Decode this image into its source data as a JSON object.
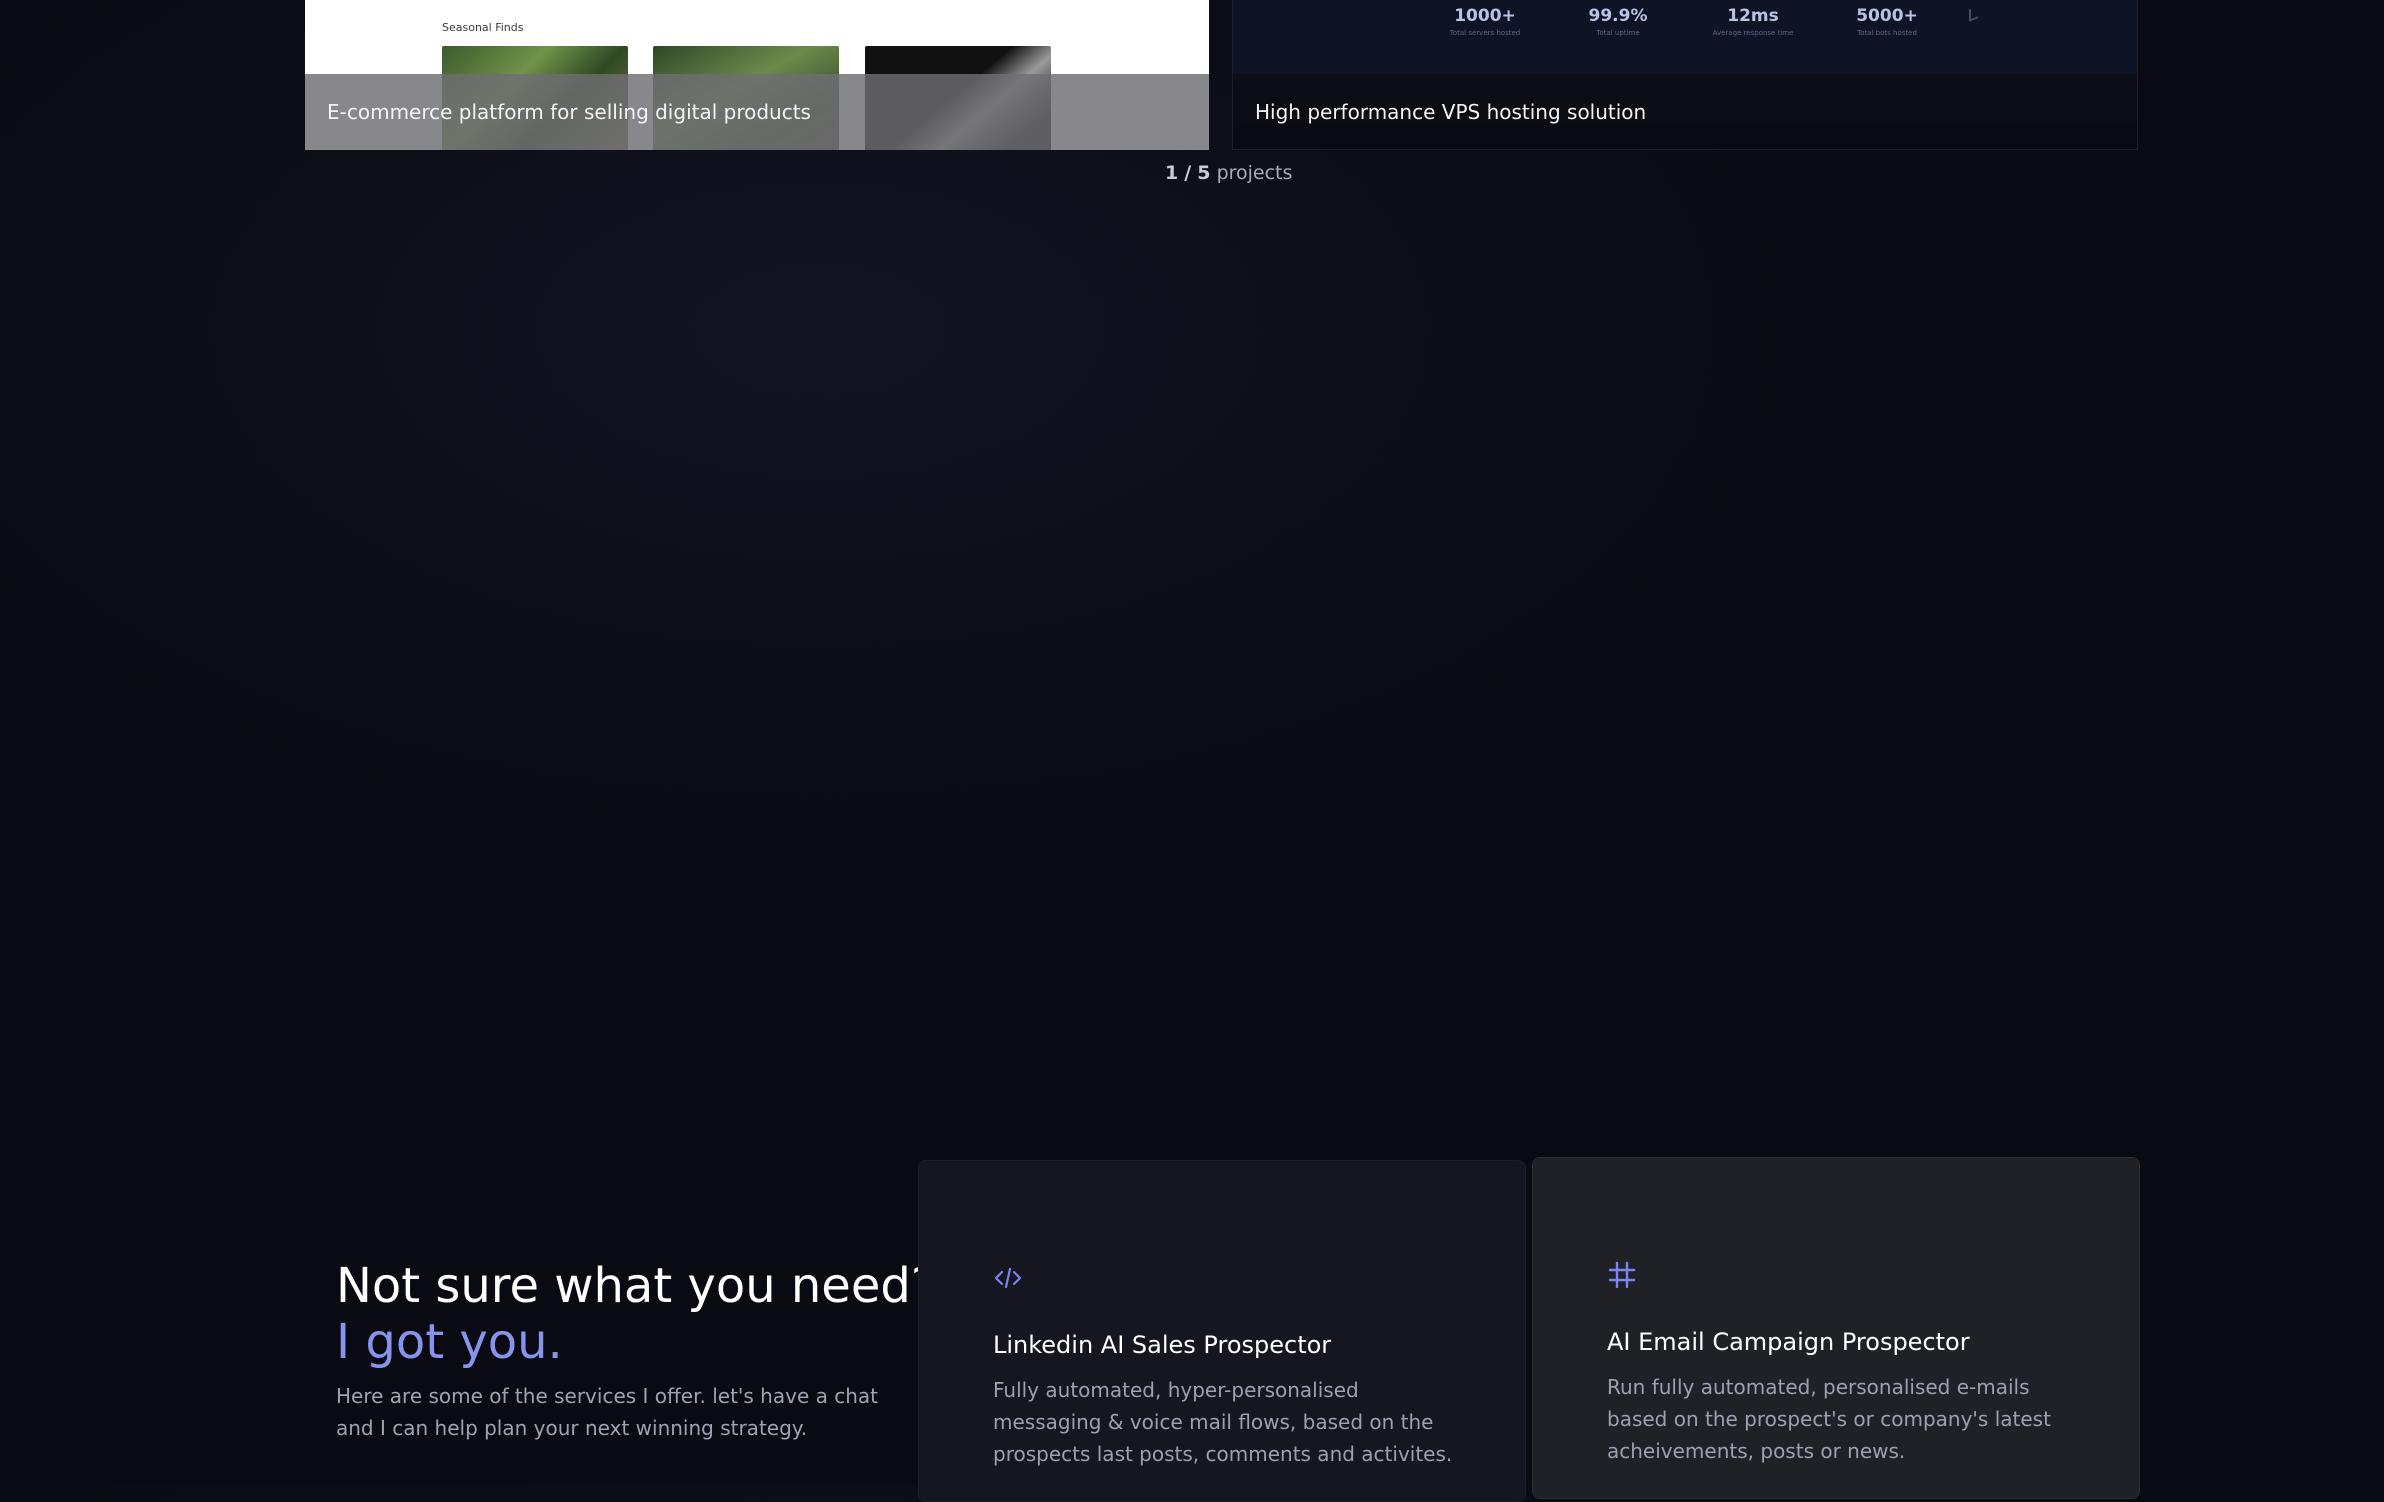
{
  "projects": {
    "left": {
      "caption": "E-commerce platform for selling digital products",
      "preview_label": "Seasonal Finds"
    },
    "right": {
      "caption": "High performance VPS hosting solution",
      "stats": [
        {
          "value": "1000+",
          "sub": "Total servers hosted"
        },
        {
          "value": "99.9%",
          "sub": "Total uptime"
        },
        {
          "value": "12ms",
          "sub": "Average response time"
        },
        {
          "value": "5000+",
          "sub": "Total bots hosted"
        }
      ]
    },
    "pagination": {
      "current": "1",
      "separator": "/",
      "total": "5",
      "label": "projects"
    }
  },
  "services": {
    "heading_line1": "Not sure what you need?",
    "heading_line2": "I got you.",
    "description": "Here are some of the services I offer. let's have a chat and I can help plan your next winning strategy.",
    "cards": [
      {
        "icon": "code-icon",
        "icon_glyph": "</>",
        "title": "Linkedin AI Sales Prospector",
        "text": "Fully automated, hyper-personalised messaging & voice mail flows, based on the prospects last posts, comments and activites."
      },
      {
        "icon": "hash-icon",
        "icon_glyph": "#",
        "title": "AI Email Campaign Prospector",
        "text": "Run fully automated, personalised e-mails based on the prospect's or company's latest acheivements, posts or news."
      }
    ]
  },
  "colors": {
    "background": "#0a0b12",
    "accent": "#8793ec",
    "icon": "#7b85f0"
  }
}
